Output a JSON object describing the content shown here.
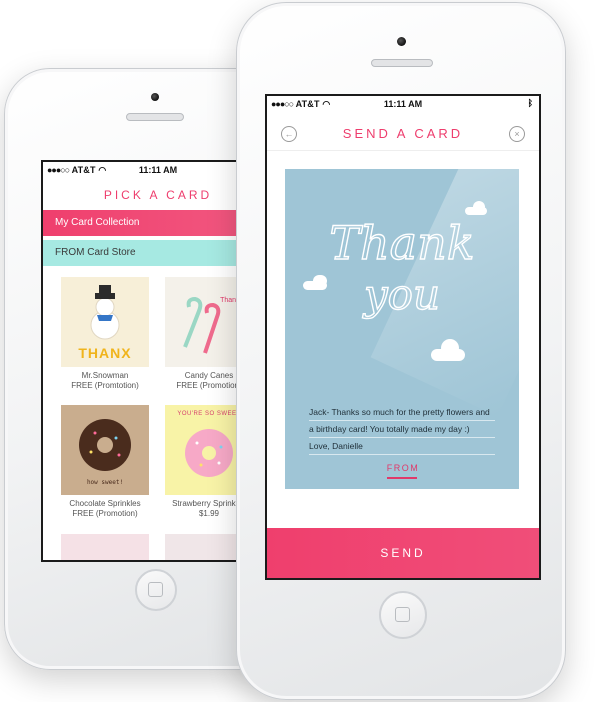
{
  "back_phone": {
    "status": {
      "carrier": "AT&T",
      "time": "11:11 AM"
    },
    "title": "PICK A CARD",
    "tabs": [
      {
        "label": "My Card Collection"
      },
      {
        "label": "FROM Card Store"
      }
    ],
    "cards": [
      {
        "name": "Mr.Snowman",
        "price": "FREE (Promtotion)",
        "art_text": "THANX"
      },
      {
        "name": "Candy Canes",
        "price": "FREE (Promotion)",
        "art_text": "Thanks!"
      },
      {
        "name": "Chocolate Sprinkles",
        "price": "FREE (Promotion)",
        "art_text": "how sweet!"
      },
      {
        "name": "Strawberry Sprinkles",
        "price": "$1.99",
        "art_text": "YOU'RE SO SWEET"
      }
    ]
  },
  "front_phone": {
    "status": {
      "carrier": "AT&T",
      "time": "11:11 AM"
    },
    "title": "SEND A CARD",
    "card": {
      "headline": "Thank you",
      "message_lines": [
        "Jack- Thanks so much for the pretty flowers and",
        "a birthday card! You totally made my day :)",
        "Love, Danielle"
      ],
      "from_label": "FROM"
    },
    "send_label": "SEND"
  },
  "colors": {
    "accent": "#ee3d6d",
    "mint": "#a6e9e2",
    "card_blue": "#9fc5d6"
  }
}
